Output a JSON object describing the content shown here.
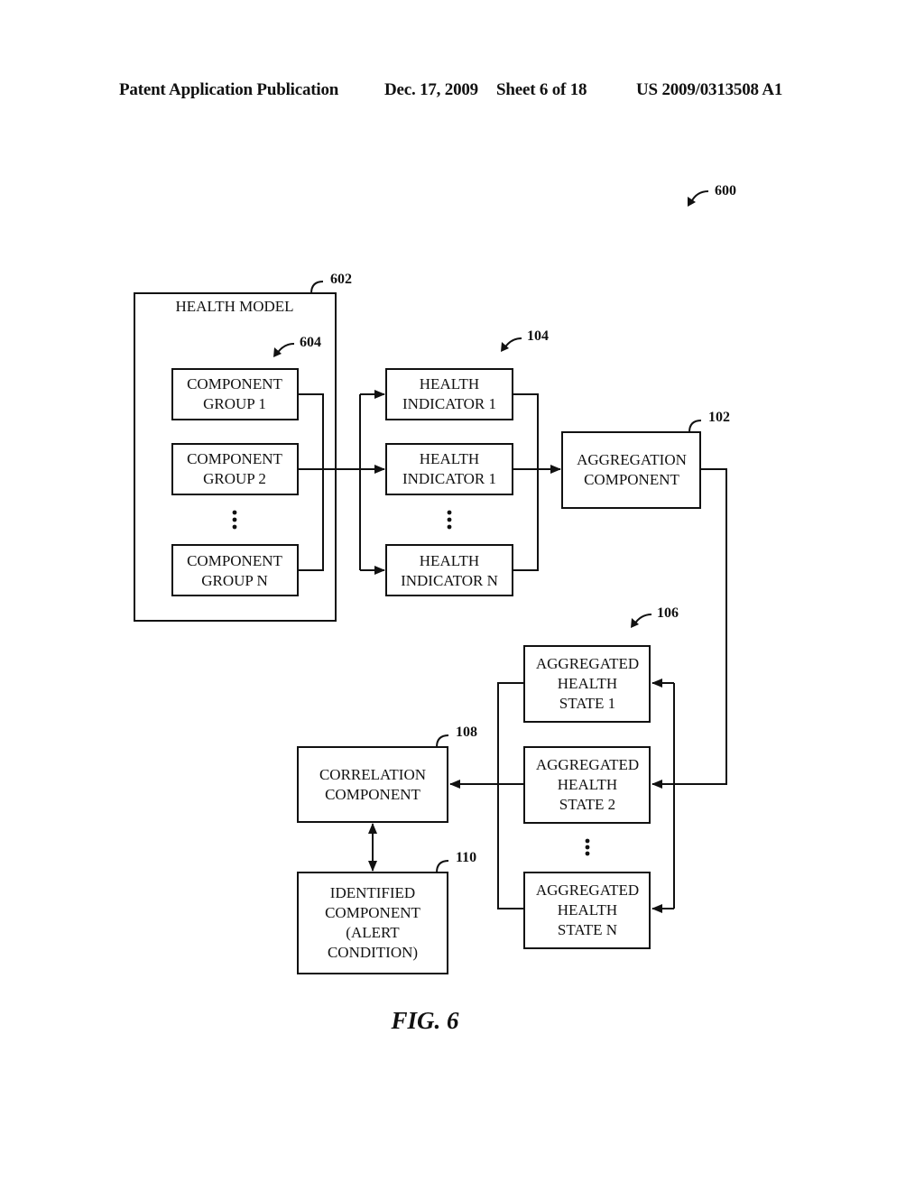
{
  "header": {
    "publication": "Patent Application Publication",
    "date": "Dec. 17, 2009",
    "sheet": "Sheet 6 of 18",
    "number": "US 2009/0313508 A1"
  },
  "figure": {
    "caption": "FIG. 6",
    "ref": "600"
  },
  "health_model": {
    "title": "HEALTH MODEL",
    "ref": "602",
    "group_ref": "604",
    "groups": [
      {
        "line1": "COMPONENT",
        "line2": "GROUP 1"
      },
      {
        "line1": "COMPONENT",
        "line2": "GROUP 2"
      },
      {
        "line1": "COMPONENT",
        "line2": "GROUP N"
      }
    ]
  },
  "health_indicators": {
    "ref": "104",
    "items": [
      {
        "line1": "HEALTH",
        "line2": "INDICATOR 1"
      },
      {
        "line1": "HEALTH",
        "line2": "INDICATOR 1"
      },
      {
        "line1": "HEALTH",
        "line2": "INDICATOR N"
      }
    ]
  },
  "aggregation": {
    "ref": "102",
    "line1": "AGGREGATION",
    "line2": "COMPONENT"
  },
  "aggregated_states": {
    "ref": "106",
    "items": [
      {
        "line1": "AGGREGATED",
        "line2": "HEALTH",
        "line3": "STATE 1"
      },
      {
        "line1": "AGGREGATED",
        "line2": "HEALTH",
        "line3": "STATE 2"
      },
      {
        "line1": "AGGREGATED",
        "line2": "HEALTH",
        "line3": "STATE N"
      }
    ]
  },
  "correlation": {
    "ref": "108",
    "line1": "CORRELATION",
    "line2": "COMPONENT"
  },
  "identified": {
    "ref": "110",
    "line1": "IDENTIFIED",
    "line2": "COMPONENT",
    "line3": "(ALERT",
    "line4": "CONDITION)"
  }
}
